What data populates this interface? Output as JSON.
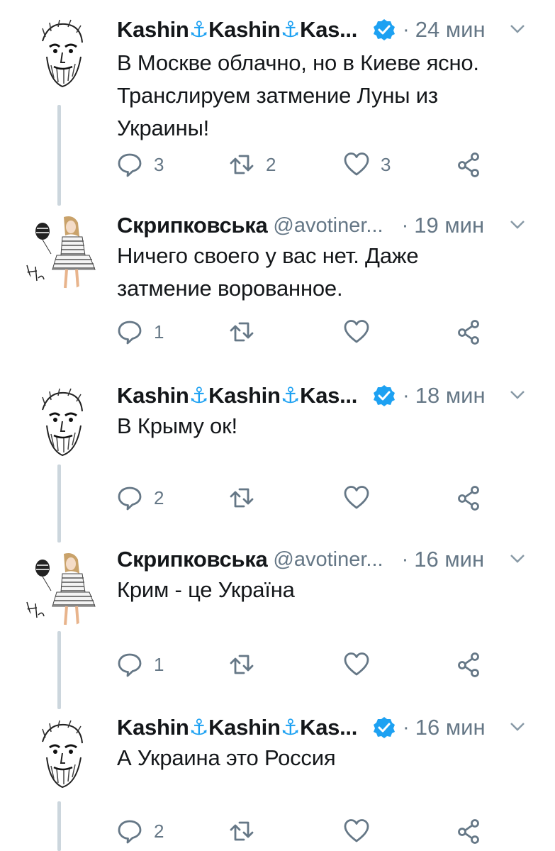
{
  "tweets": [
    {
      "author": "kashin",
      "name_parts": [
        "Kashin",
        "⚓",
        "Kashin",
        "⚓",
        "Kas..."
      ],
      "handle": "",
      "verified": true,
      "dot": "·",
      "time": "24 мин",
      "text_lines": [
        "В Москве облачно, но в Киеве ясно.",
        "Транслируем затмение Луны из",
        "Украины!"
      ],
      "reply_count": "3",
      "retweet_count": "2",
      "like_count": "3"
    },
    {
      "author": "skripkovska",
      "name": "Скрипковська",
      "handle": "@avotiner...",
      "verified": false,
      "dot": "·",
      "time": "19 мин",
      "text_lines": [
        "Ничего своего у вас нет. Даже",
        "затмение ворованное."
      ],
      "reply_count": "1",
      "retweet_count": "",
      "like_count": ""
    },
    {
      "author": "kashin",
      "name_parts": [
        "Kashin",
        "⚓",
        "Kashin",
        "⚓",
        "Kas..."
      ],
      "handle": "",
      "verified": true,
      "dot": "·",
      "time": "18 мин",
      "text_lines": [
        "В Крыму ок!"
      ],
      "reply_count": "2",
      "retweet_count": "",
      "like_count": ""
    },
    {
      "author": "skripkovska",
      "name": "Скрипковська",
      "handle": "@avotiner...",
      "verified": false,
      "dot": "·",
      "time": "16 мин",
      "text_lines": [
        "Крим - це Україна"
      ],
      "reply_count": "1",
      "retweet_count": "",
      "like_count": ""
    },
    {
      "author": "kashin",
      "name_parts": [
        "Kashin",
        "⚓",
        "Kashin",
        "⚓",
        "Kas..."
      ],
      "handle": "",
      "verified": true,
      "dot": "·",
      "time": "16 мин",
      "text_lines": [
        "А Украина это Россия"
      ],
      "reply_count": "2",
      "retweet_count": "",
      "like_count": ""
    }
  ],
  "icons": {
    "reply": "reply-icon",
    "retweet": "retweet-icon",
    "like": "heart-icon",
    "share": "share-icon",
    "verified": "verified-badge-icon",
    "caret": "chevron-down-icon"
  },
  "colors": {
    "text": "#14171a",
    "secondary": "#657786",
    "verified": "#1da1f2",
    "thread_line": "#ccd6dd"
  }
}
